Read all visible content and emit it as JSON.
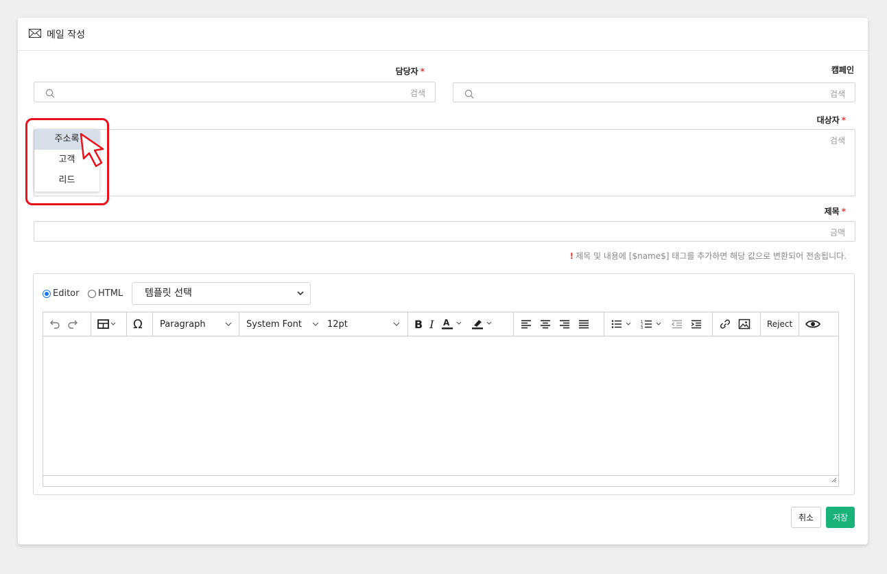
{
  "header": {
    "title": "메일 작성",
    "icon": "envelope-icon"
  },
  "fields": {
    "manager": {
      "label": "담당자",
      "required": true,
      "placeholder": "검색"
    },
    "campaign": {
      "label": "캠페인",
      "required": false,
      "placeholder": "검색"
    },
    "recipient": {
      "label": "대상자",
      "required": true,
      "placeholder": "검색"
    },
    "subject": {
      "label": "제목",
      "required": true,
      "placeholder": "금액"
    }
  },
  "recipient_dropdown": {
    "items": [
      "주소록",
      "고객",
      "리드"
    ],
    "selected": "주소록"
  },
  "hint": {
    "bang": "!",
    "text": "제목 및 내용에 [$name$] 태그를 추가하면 해당 값으로 변환되어 전송됩니다."
  },
  "editor": {
    "modes": [
      "Editor",
      "HTML"
    ],
    "selected_mode": "Editor",
    "template_select": "템플릿 선택",
    "toolbar": {
      "block_format": "Paragraph",
      "font_family": "System Font",
      "font_size": "12pt",
      "reject_label": "Reject"
    }
  },
  "buttons": {
    "cancel": "취소",
    "save": "저장"
  },
  "colors": {
    "accent": "#19b37a",
    "required": "#e53935",
    "highlight": "#e8101a",
    "radio": "#1a73e8"
  }
}
